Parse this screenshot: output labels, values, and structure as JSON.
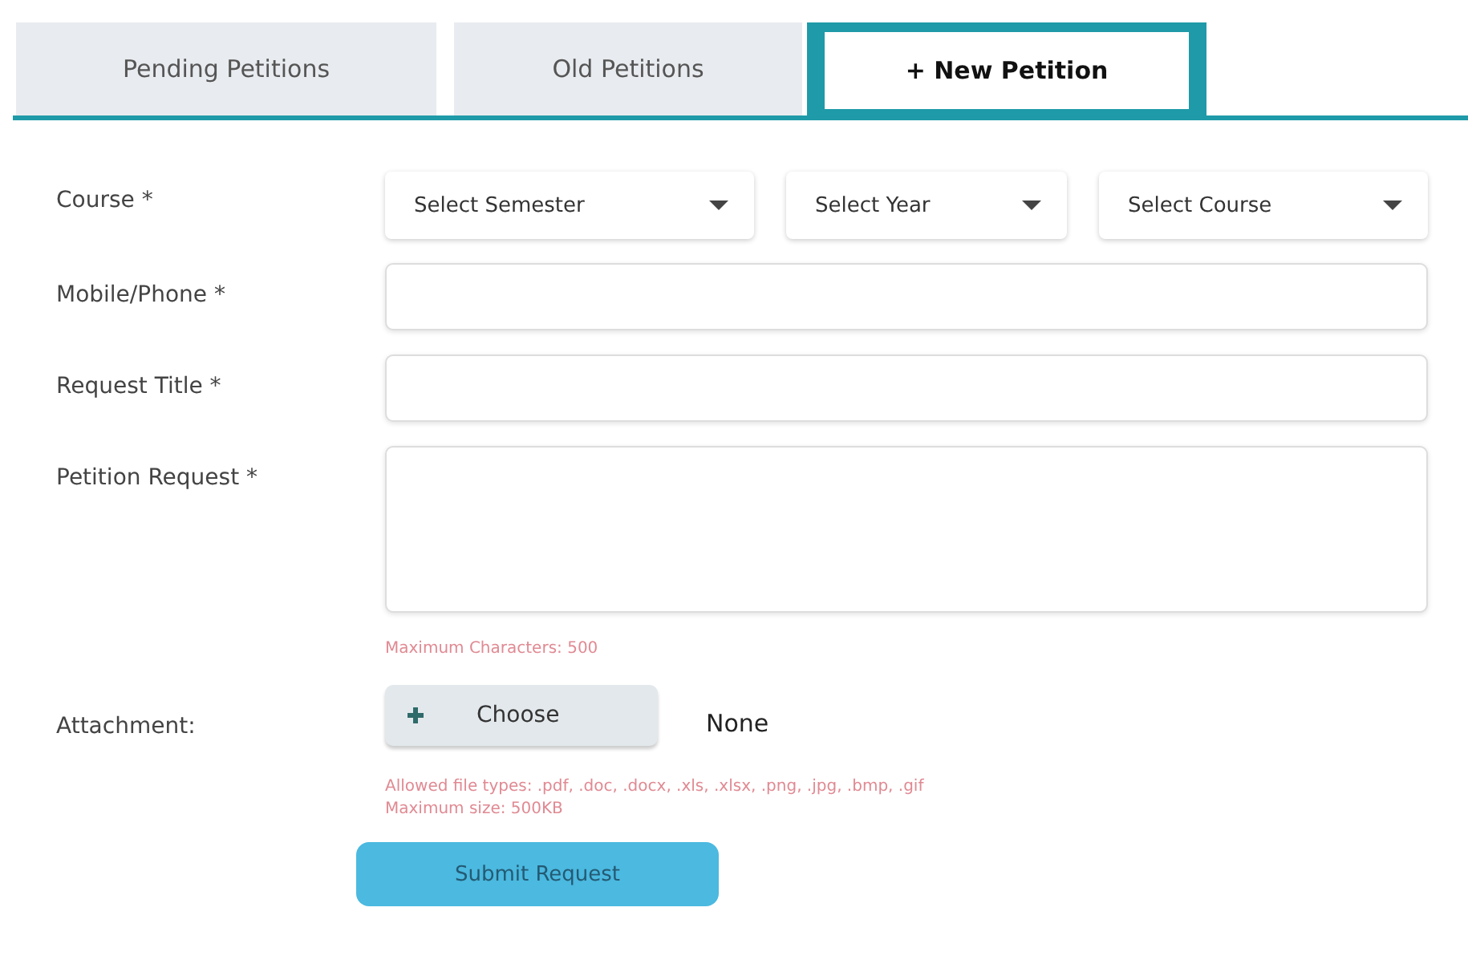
{
  "tabs": [
    {
      "label": "Pending Petitions",
      "selected": false
    },
    {
      "label": "Old Petitions",
      "selected": false
    },
    {
      "label": "+ New Petition",
      "selected": true
    }
  ],
  "form": {
    "course": {
      "label": "Course *",
      "selects": [
        {
          "placeholder": "Select Semester"
        },
        {
          "placeholder": "Select Year"
        },
        {
          "placeholder": "Select Course"
        }
      ]
    },
    "mobile": {
      "label": "Mobile/Phone *"
    },
    "title": {
      "label": "Request Title *"
    },
    "request": {
      "label": "Petition Request *",
      "hint": "Maximum Characters: 500"
    },
    "attachment": {
      "label": "Attachment:",
      "button": "Choose",
      "file": "None",
      "hints": [
        "Allowed file types: .pdf, .doc, .docx, .xls, .xlsx, .png, .jpg, .bmp, .gif",
        "Maximum size: 500KB"
      ]
    },
    "submit": "Submit Request"
  }
}
